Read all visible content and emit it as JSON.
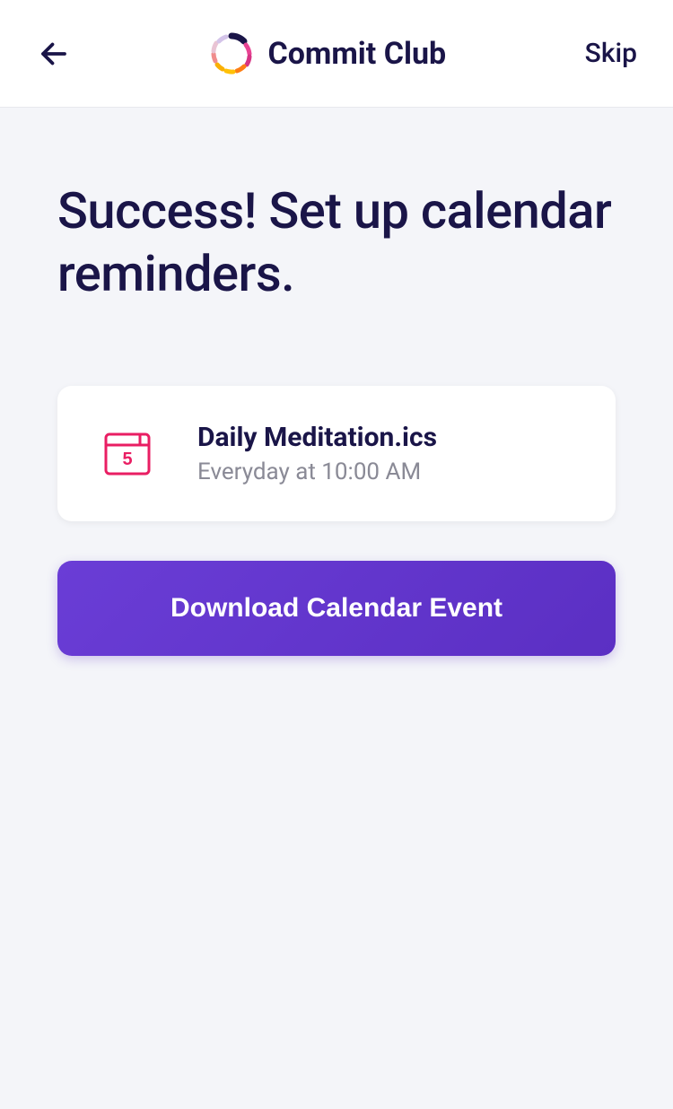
{
  "header": {
    "title": "Commit Club",
    "skip_label": "Skip"
  },
  "main": {
    "heading": "Success! Set up calendar reminders.",
    "file": {
      "name": "Daily Meditation.ics",
      "subtitle": "Everyday at 10:00 AM"
    },
    "download_label": "Download Calendar Event"
  }
}
